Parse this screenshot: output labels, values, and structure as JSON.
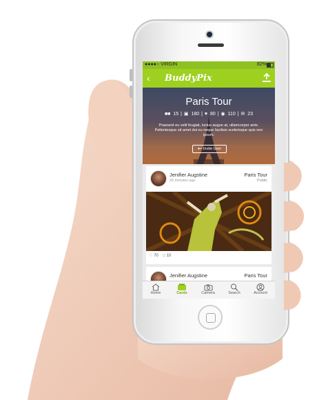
{
  "status_bar": {
    "carrier": "●●●●○ VIRGIN",
    "time": "",
    "battery": "82%"
  },
  "header": {
    "logo": "BuddyPix",
    "back_glyph": "‹"
  },
  "album": {
    "title": "Paris Tour",
    "stats": [
      {
        "icon": "users-icon",
        "value": "15"
      },
      {
        "icon": "photo-icon",
        "value": "180"
      },
      {
        "icon": "heart-icon",
        "value": "80"
      },
      {
        "icon": "eye-icon",
        "value": "110"
      },
      {
        "icon": "comment-icon",
        "value": "23"
      }
    ],
    "description": "Praesent eu velit feugiat, luctus augue at, ullamcorper ante. Pellentesque sit amet dui eu neque facilisis scelerisque quis non ipsum.",
    "invite_label": "Invite User"
  },
  "posts": [
    {
      "user": "Jenifier Augstine",
      "time": "20 minutes ago",
      "group": "Paris Tour",
      "privacy": "Public",
      "likes": "70",
      "comments": "10"
    },
    {
      "user": "Jenifier Augstine",
      "time": "",
      "group": "Paris Tour",
      "privacy": "",
      "likes": "",
      "comments": ""
    }
  ],
  "tabs": [
    {
      "label": "Home",
      "icon": "home-icon"
    },
    {
      "label": "Cards",
      "icon": "cards-icon",
      "active": true
    },
    {
      "label": "Camera",
      "icon": "camera-icon"
    },
    {
      "label": "Search",
      "icon": "search-icon"
    },
    {
      "label": "Account",
      "icon": "account-icon"
    }
  ],
  "colors": {
    "accent": "#9ed01f",
    "status_bar": "#8fc123",
    "active_tab": "#7ea21a"
  }
}
